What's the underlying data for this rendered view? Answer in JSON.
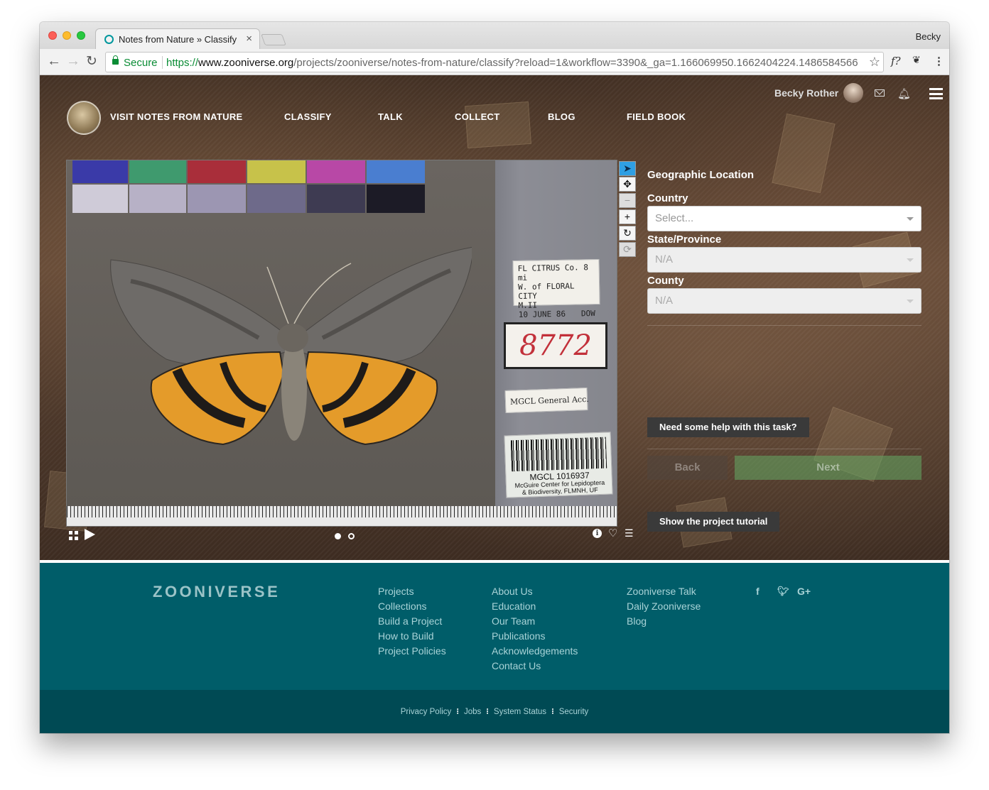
{
  "browser": {
    "tab_title": "Notes from Nature » Classify",
    "profile_name": "Becky",
    "secure_label": "Secure",
    "url_scheme": "https://",
    "url_host": "www.zooniverse.org",
    "url_path": "/projects/zooniverse/notes-from-nature/classify?reload=1&workflow=3390&_ga=1.166069950.1662404224.1486584566",
    "ext_label": "f?"
  },
  "nav": {
    "visit": "VISIT NOTES FROM NATURE",
    "classify": "CLASSIFY",
    "talk": "TALK",
    "collect": "COLLECT",
    "blog": "BLOG",
    "field_book": "FIELD BOOK"
  },
  "user": {
    "name": "Becky Rother"
  },
  "specimen": {
    "locality_line1": "FL CITRUS Co. 8 mi",
    "locality_line2": "W. of FLORAL CITY",
    "locality_line3": "M.II",
    "locality_date": "10 JUNE 86",
    "collector": "DOW",
    "catalog_number": "8772",
    "collection_label": "MGCL General Acc.",
    "barcode_id": "MGCL 1016937",
    "barcode_line2": "McGuire Center for Lepidoptera",
    "barcode_line3": "& Biodiversity, FLMNH, UF"
  },
  "viewer": {
    "tools": [
      "pointer-icon",
      "move-icon",
      "zoom-out-icon",
      "zoom-in-icon",
      "rotate-icon",
      "reset-icon"
    ],
    "page_dots": 2,
    "active_dot": 0
  },
  "task": {
    "title": "Geographic Location",
    "country_label": "Country",
    "country_placeholder": "Select...",
    "state_label": "State/Province",
    "state_value": "N/A",
    "county_label": "County",
    "county_value": "N/A",
    "help_button": "Need some help with this task?",
    "back_button": "Back",
    "next_button": "Next",
    "tutorial_button": "Show the project tutorial"
  },
  "footer": {
    "logo": "ZOONIVERSE",
    "col1": [
      "Projects",
      "Collections",
      "Build a Project",
      "How to Build",
      "Project Policies"
    ],
    "col2": [
      "About Us",
      "Education",
      "Our Team",
      "Publications",
      "Acknowledgements",
      "Contact Us"
    ],
    "col3": [
      "Zooniverse Talk",
      "Daily Zooniverse",
      "Blog"
    ],
    "social": [
      "f",
      "t",
      "G+"
    ],
    "bottom": [
      "Privacy Policy",
      "Jobs",
      "System Status",
      "Security"
    ]
  }
}
